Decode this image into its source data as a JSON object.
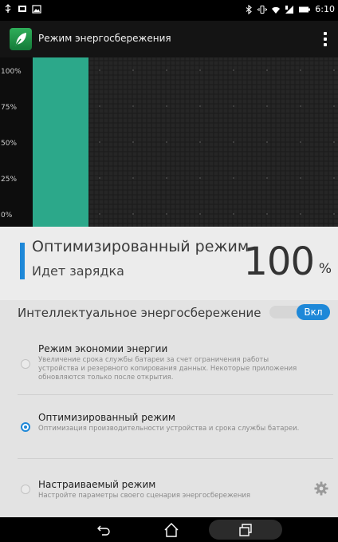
{
  "status_bar": {
    "time": "6:10",
    "left_icons": [
      "usb-icon",
      "screen-cast-icon",
      "image-icon"
    ],
    "right_icons": [
      "bluetooth-icon",
      "vibrate-icon",
      "wifi-icon",
      "signal-icon",
      "battery-icon"
    ]
  },
  "app_bar": {
    "title": "Режим энергосбережения",
    "logo_icon": "leaf-icon",
    "menu_icon": "overflow-menu-icon"
  },
  "chart_data": {
    "type": "bar",
    "y_tick_labels": [
      "100%",
      "75%",
      "50%",
      "25%",
      "0%"
    ],
    "ylim": [
      0,
      100
    ],
    "values": [
      100
    ],
    "grid": true,
    "bar_color": "#2ca88a",
    "background": "#0d0d0d"
  },
  "summary": {
    "mode_title": "Оптимизированный режим",
    "status": "Идет зарядка",
    "percent": "100",
    "percent_unit": "%",
    "accent": "#1e88d8"
  },
  "smart_saving": {
    "label": "Интеллектуальное энергосбережение",
    "toggle_label": "Вкл",
    "enabled": true
  },
  "options": [
    {
      "title": "Режим экономии энергии",
      "description": "Увеличение срока службы батареи за счет ограничения работы устройства и резервного копирования данных. Некоторые приложения обновляются только после открытия.",
      "selected": false
    },
    {
      "title": "Оптимизированный режим",
      "description": "Оптимизация производительности устройства и срока службы батареи.",
      "selected": true
    },
    {
      "title": "Настраиваемый режим",
      "description": "Настройте параметры своего сценария энергосбережения",
      "selected": false,
      "settings_icon": "gear-icon"
    }
  ],
  "nav_bar": {
    "icons": [
      "back-icon",
      "home-icon",
      "recent-apps-icon"
    ]
  }
}
